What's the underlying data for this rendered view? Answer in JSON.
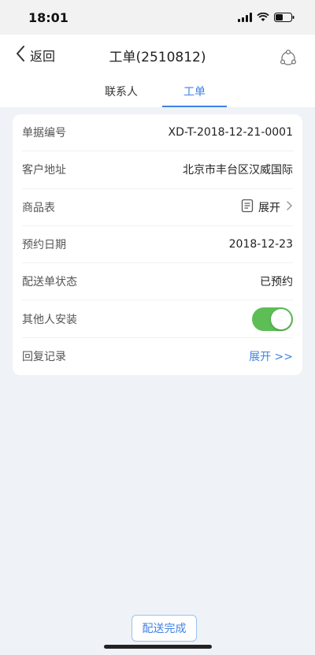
{
  "status_bar": {
    "time": "18:01"
  },
  "nav": {
    "back_label": "返回",
    "title": "工单(2510812)",
    "share_icon": "share-icon"
  },
  "tabs": [
    {
      "label": "联系人",
      "active": false
    },
    {
      "label": "工单",
      "active": true
    }
  ],
  "details": {
    "order_no": {
      "label": "单据编号",
      "value": "XD-T-2018-12-21-0001"
    },
    "address": {
      "label": "客户地址",
      "value": "北京市丰台区汉威国际"
    },
    "products": {
      "label": "商品表",
      "value": "展开"
    },
    "appointment": {
      "label": "预约日期",
      "value": "2018-12-23"
    },
    "delivery_status": {
      "label": "配送单状态",
      "value": "已预约"
    },
    "other_install": {
      "label": "其他人安装",
      "on": true
    },
    "reply_log": {
      "label": "回复记录",
      "value": "展开 >>"
    }
  },
  "footer": {
    "complete_label": "配送完成"
  },
  "colors": {
    "accent": "#3f83e6",
    "toggle_on": "#5dbe56",
    "background": "#eff2f6"
  }
}
